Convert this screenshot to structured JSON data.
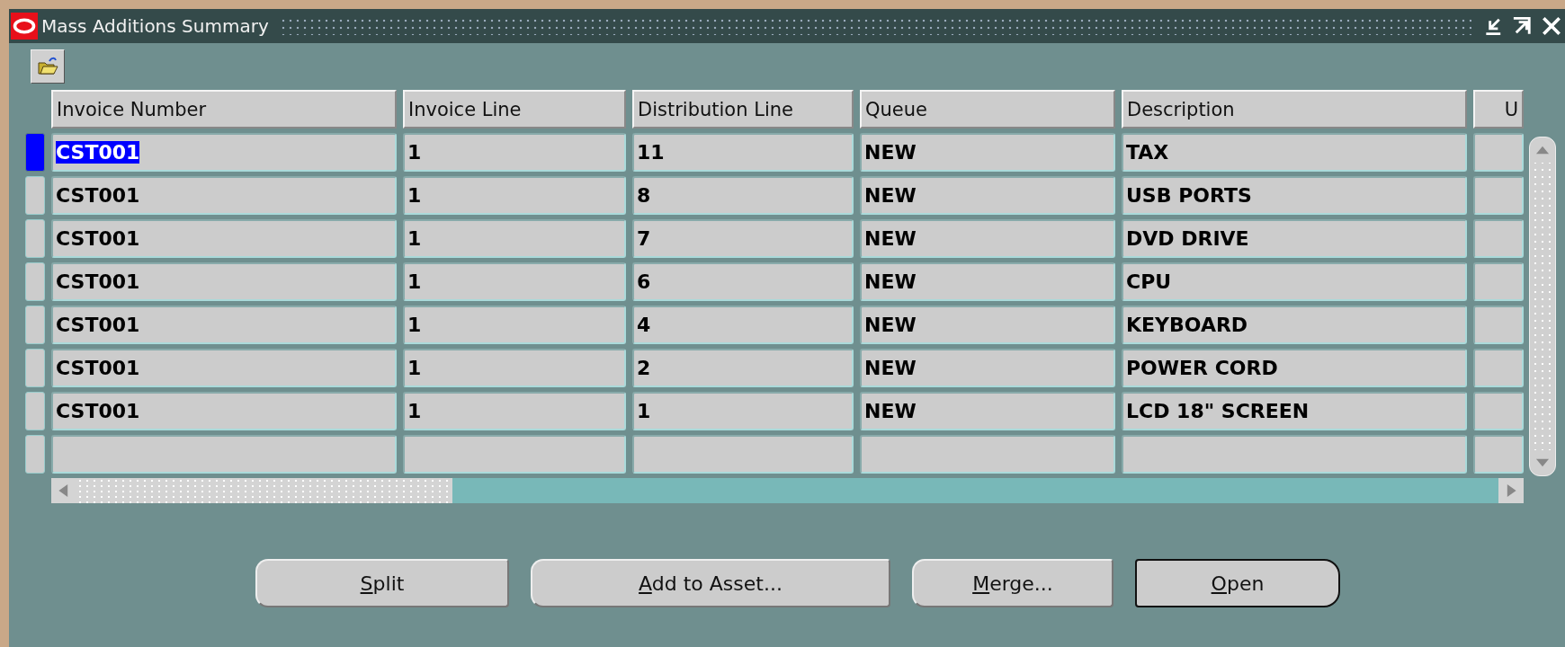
{
  "window": {
    "title": "Mass Additions Summary"
  },
  "table": {
    "columns": [
      "Invoice Number",
      "Invoice Line",
      "Distribution Line",
      "Queue",
      "Description",
      "U"
    ],
    "rows": [
      {
        "selected": true,
        "cells": [
          "CST001",
          "1",
          "11",
          "NEW",
          "TAX"
        ]
      },
      {
        "selected": false,
        "cells": [
          "CST001",
          "1",
          "8",
          "NEW",
          "USB PORTS"
        ]
      },
      {
        "selected": false,
        "cells": [
          "CST001",
          "1",
          "7",
          "NEW",
          "DVD DRIVE"
        ]
      },
      {
        "selected": false,
        "cells": [
          "CST001",
          "1",
          "6",
          "NEW",
          "CPU"
        ]
      },
      {
        "selected": false,
        "cells": [
          "CST001",
          "1",
          "4",
          "NEW",
          "KEYBOARD"
        ]
      },
      {
        "selected": false,
        "cells": [
          "CST001",
          "1",
          "2",
          "NEW",
          "POWER CORD"
        ]
      },
      {
        "selected": false,
        "cells": [
          "CST001",
          "1",
          "1",
          "NEW",
          "LCD 18\" SCREEN"
        ]
      }
    ]
  },
  "buttons": [
    {
      "label": "Split",
      "default": false
    },
    {
      "label": "Add to Asset...",
      "default": false
    },
    {
      "label": "Merge...",
      "default": false
    },
    {
      "label": "Open",
      "default": true
    }
  ]
}
